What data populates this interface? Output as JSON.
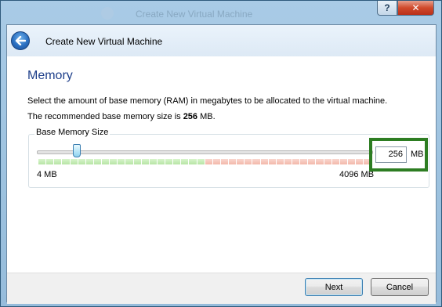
{
  "window": {
    "ghost_title": "Create New Virtual Machine",
    "help_label": "?",
    "close_label": "✕"
  },
  "header": {
    "title": "Create New Virtual Machine"
  },
  "page": {
    "title": "Memory",
    "description": "Select the amount of base memory (RAM) in megabytes to be allocated to the virtual machine.",
    "recommended_prefix": "The recommended base memory size is ",
    "recommended_value": "256",
    "recommended_suffix": " MB."
  },
  "memory": {
    "group_label": "Base Memory Size",
    "value": "256",
    "unit": "MB",
    "min_label": "4 MB",
    "max_label": "4096 MB",
    "min_mb": 4,
    "max_mb": 4096,
    "current_mb": 256,
    "recommended_green_fraction": 0.5
  },
  "buttons": {
    "next": "Next",
    "cancel": "Cancel"
  },
  "colors": {
    "accent": "#1e3f8a",
    "highlight_box": "#2d7d22",
    "safe_range": "#b7e5a5",
    "unsafe_range": "#f3b8aa"
  }
}
